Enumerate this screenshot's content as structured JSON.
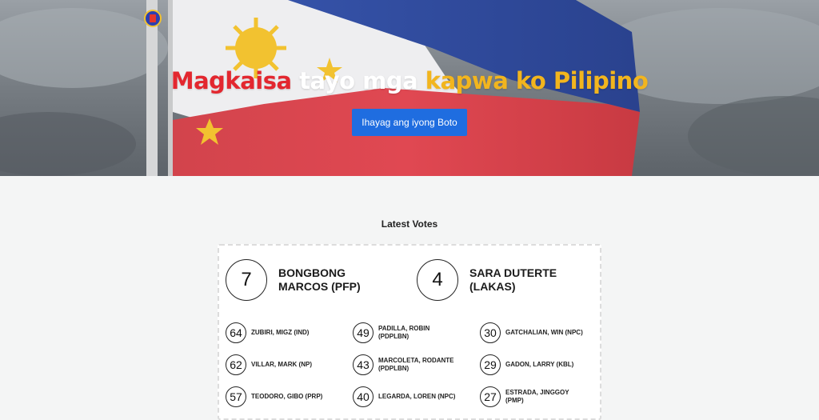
{
  "hero": {
    "headline": {
      "word1": "Magkaisa",
      "word2": "tayo mga",
      "word3": "kapwa ko Pilipino"
    },
    "cta_label": "Ihayag ang iyong Boto"
  },
  "votes": {
    "title": "Latest Votes",
    "top": [
      {
        "number": "7",
        "name": "BONGBONG MARCOS (PFP)"
      },
      {
        "number": "4",
        "name": "SARA DUTERTE (LAKAS)"
      }
    ],
    "senators": [
      {
        "number": "64",
        "name": "ZUBIRI, MIGZ (IND)"
      },
      {
        "number": "49",
        "name": "PADILLA, ROBIN (PDPLBN)"
      },
      {
        "number": "30",
        "name": "GATCHALIAN, WIN (NPC)"
      },
      {
        "number": "62",
        "name": "VILLAR, MARK (NP)"
      },
      {
        "number": "43",
        "name": "MARCOLETA, RODANTE (PDPLBN)"
      },
      {
        "number": "29",
        "name": "GADON, LARRY (KBL)"
      },
      {
        "number": "57",
        "name": "TEODORO, GIBO (PRP)"
      },
      {
        "number": "40",
        "name": "LEGARDA, LOREN (NPC)"
      },
      {
        "number": "27",
        "name": "ESTRADA, JINGGOY (PMP)"
      }
    ]
  }
}
